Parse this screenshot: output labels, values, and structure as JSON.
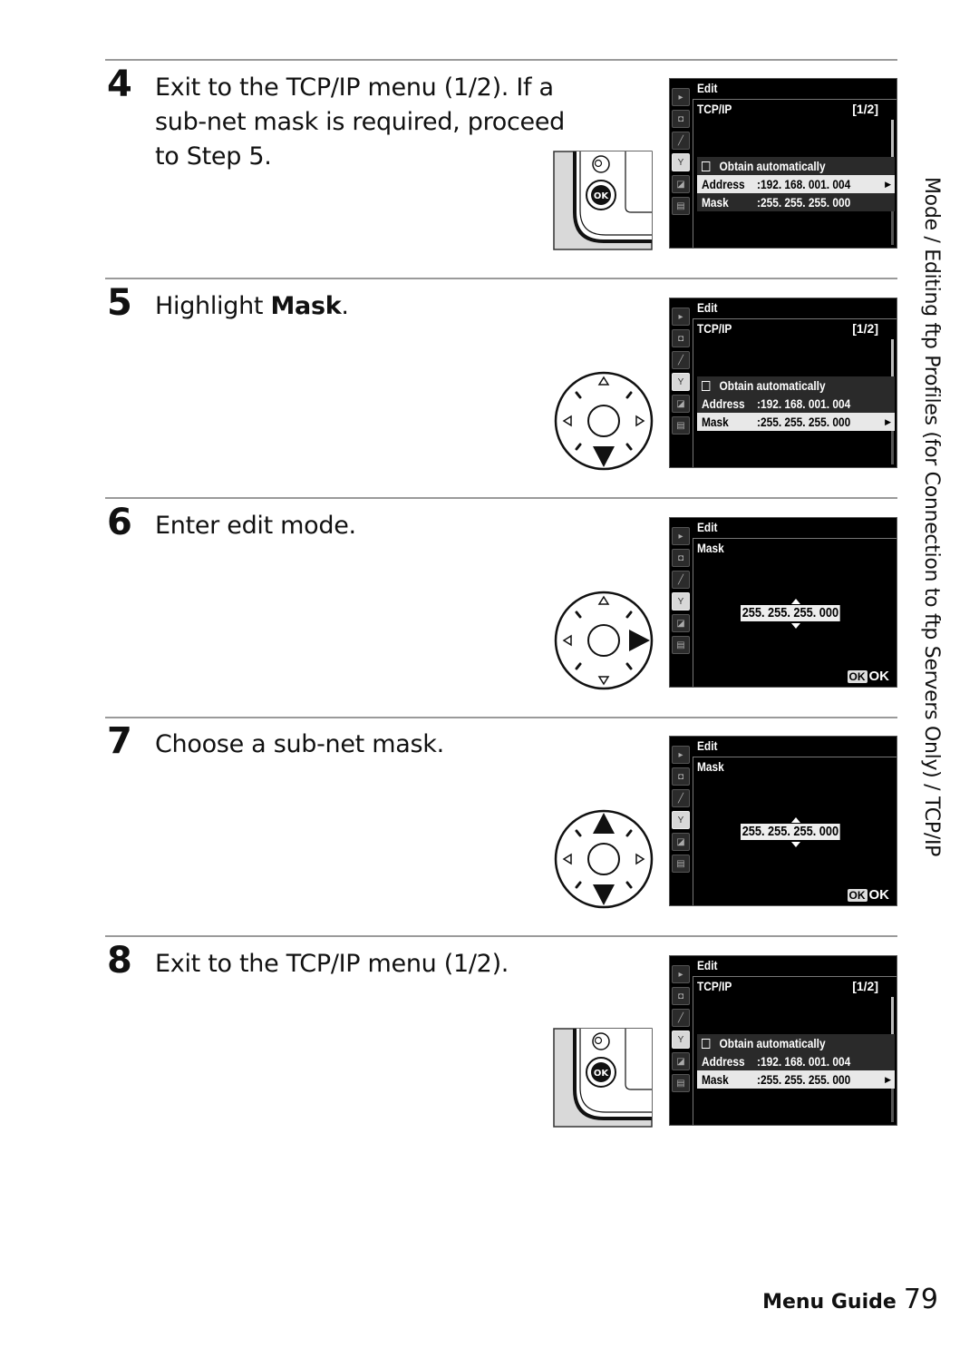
{
  "steps": [
    {
      "number": "4",
      "text": "Exit to the TCP/IP menu (1/2).  If a sub-net mask is required, proceed to Step 5.",
      "control": "ok-button"
    },
    {
      "number": "5",
      "text_prefix": "Highlight ",
      "text_bold": "Mask",
      "text_suffix": ".",
      "control": "multi-selector-down"
    },
    {
      "number": "6",
      "text": "Enter edit mode.",
      "control": "multi-selector-right"
    },
    {
      "number": "7",
      "text": "Choose a sub-net mask.",
      "control": "multi-selector-up-down"
    },
    {
      "number": "8",
      "text": "Exit to the TCP/IP menu (1/2).",
      "control": "ok-button"
    }
  ],
  "screens": {
    "list": {
      "header": "Edit",
      "title": "TCP/IP",
      "page": "[1/2]",
      "obtain_label": "Obtain automatically",
      "address_label": "Address",
      "address_value": ":192. 168. 001. 004",
      "mask_label": "Mask",
      "mask_value": ":255. 255. 255. 000"
    },
    "edit": {
      "header": "Edit",
      "title": "Mask",
      "value": "255. 255. 255. 000",
      "ok_icon": "OK",
      "ok_label": "OK"
    }
  },
  "tab_icons": [
    "playback-icon",
    "camera-icon",
    "pencil-icon",
    "wrench-icon",
    "retouch-icon",
    "recent-settings-icon"
  ],
  "side_title": "Mode / Editing ftp Profiles (for Connection to ftp Servers Only) / TCP/IP",
  "footer": {
    "label": "Menu Guide",
    "page": "79"
  }
}
